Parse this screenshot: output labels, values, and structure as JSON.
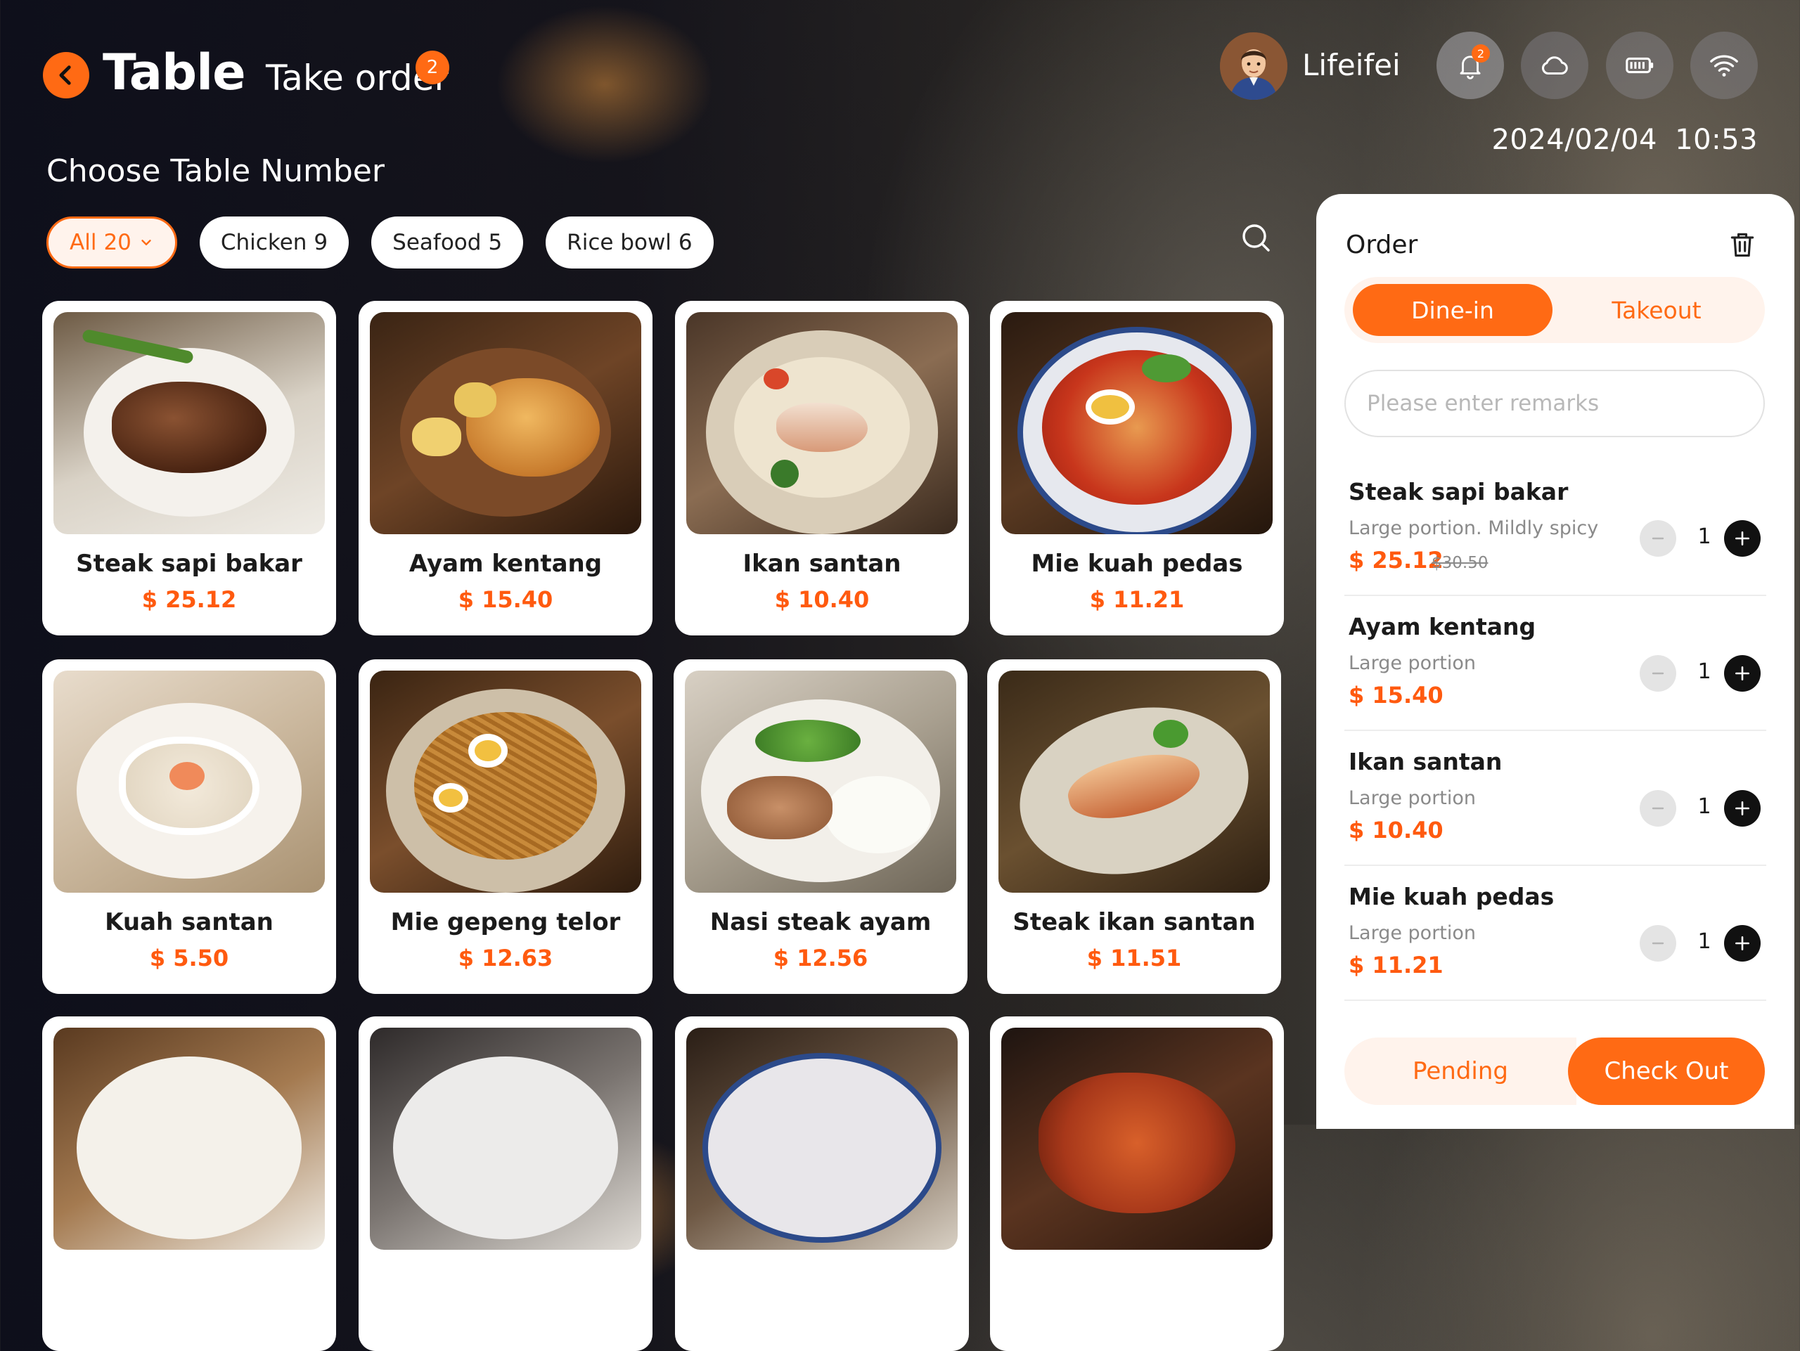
{
  "header": {
    "title": "Table",
    "take_order_label": "Take order",
    "take_order_badge": "2",
    "user_name": "Lifeifei",
    "bell_badge": "2",
    "date": "2024/02/04",
    "time": "10:53",
    "icons": [
      "back-arrow-icon",
      "bell-icon",
      "cloud-icon",
      "battery-icon",
      "wifi-icon",
      "search-icon",
      "trash-icon"
    ]
  },
  "section_title": "Choose Table Number",
  "filters": [
    {
      "label": "All",
      "count": "20",
      "active": true
    },
    {
      "label": "Chicken",
      "count": "9"
    },
    {
      "label": "Seafood",
      "count": "5"
    },
    {
      "label": "Rice bowl",
      "count": "6"
    }
  ],
  "dishes": [
    {
      "name": "Steak sapi bakar",
      "price": "$ 25.12"
    },
    {
      "name": "Ayam kentang",
      "price": "$ 15.40"
    },
    {
      "name": "Ikan santan",
      "price": "$ 10.40"
    },
    {
      "name": "Mie kuah pedas",
      "price": "$ 11.21"
    },
    {
      "name": "Kuah santan",
      "price": "$ 5.50"
    },
    {
      "name": "Mie gepeng telor",
      "price": "$ 12.63"
    },
    {
      "name": "Nasi steak ayam",
      "price": "$ 12.56"
    },
    {
      "name": "Steak ikan santan",
      "price": "$ 11.51"
    },
    {
      "name": "",
      "price": ""
    },
    {
      "name": "",
      "price": ""
    },
    {
      "name": "",
      "price": ""
    },
    {
      "name": "",
      "price": ""
    }
  ],
  "order": {
    "title": "Order",
    "dine_in": "Dine-in",
    "takeout": "Takeout",
    "remarks_placeholder": "Please enter remarks",
    "items": [
      {
        "name": "Steak sapi bakar",
        "desc": "Large portion. Mildly spicy",
        "price": "$ 25.12",
        "original_price": "$30.50",
        "qty": "1"
      },
      {
        "name": "Ayam kentang",
        "desc": "Large portion",
        "price": "$ 15.40",
        "original_price": "",
        "qty": "1"
      },
      {
        "name": "Ikan santan",
        "desc": "Large portion",
        "price": "$ 10.40",
        "original_price": "",
        "qty": "1"
      },
      {
        "name": "Mie kuah pedas",
        "desc": "Large portion",
        "price": "$ 11.21",
        "original_price": "",
        "qty": "1"
      }
    ],
    "pending_label": "Pending",
    "checkout_label": "Check Out"
  },
  "colors": {
    "accent": "#ff6a14",
    "price": "#ff5a0f",
    "panel": "#ffffff"
  }
}
